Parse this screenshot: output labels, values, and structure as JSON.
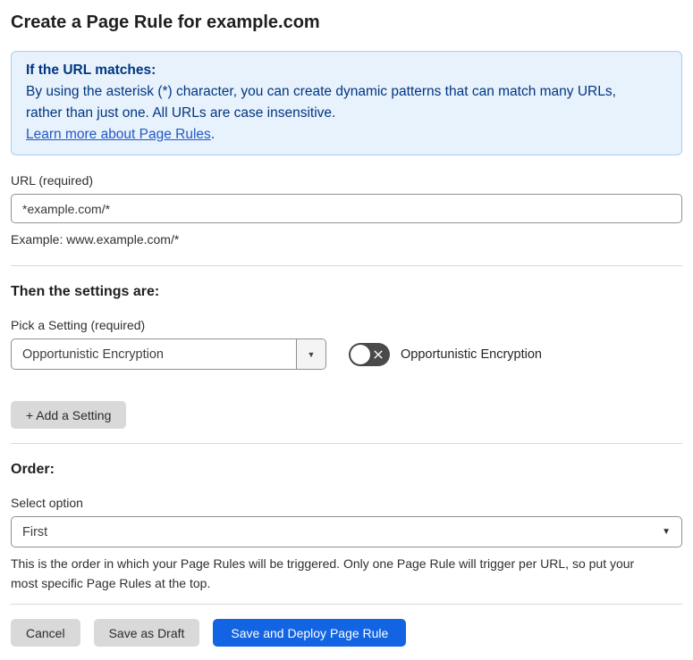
{
  "page": {
    "title": "Create a Page Rule for example.com"
  },
  "info_box": {
    "heading": "If the URL matches:",
    "body_lines": [
      "By using the asterisk (*) character, you can create dynamic patterns that can match many URLs,",
      "rather than just one. All URLs are case insensitive."
    ],
    "link_label": "Learn more about Page Rules",
    "link_suffix": "."
  },
  "url_field": {
    "label": "URL (required)",
    "value": "*example.com/*",
    "helper": "Example: www.example.com/*"
  },
  "settings_section": {
    "heading": "Then the settings are:",
    "picker_label": "Pick a Setting (required)",
    "selected_setting": "Opportunistic Encryption",
    "dropdown_arrow": "▼",
    "toggle_state": "off",
    "toggle_label": "Opportunistic Encryption",
    "add_setting_label": "+ Add a Setting"
  },
  "order_section": {
    "heading": "Order:",
    "select_label": "Select option",
    "selected_option": "First",
    "chevron": "▼",
    "helper_lines": [
      "This is the order in which your Page Rules will be triggered. Only one Page Rule will trigger per URL, so put your",
      "most specific Page Rules at the top."
    ]
  },
  "footer": {
    "cancel_label": "Cancel",
    "save_draft_label": "Save as Draft",
    "save_deploy_label": "Save and Deploy Page Rule"
  },
  "colors": {
    "accent_blue": "#1264e3",
    "info_box_bg": "#e8f2fc",
    "info_box_border": "#abcdf0",
    "info_box_text": "#003681",
    "link_blue": "#2158c7",
    "button_gray": "#d9d9d9",
    "toggle_off_bg": "#4a4a4a"
  }
}
